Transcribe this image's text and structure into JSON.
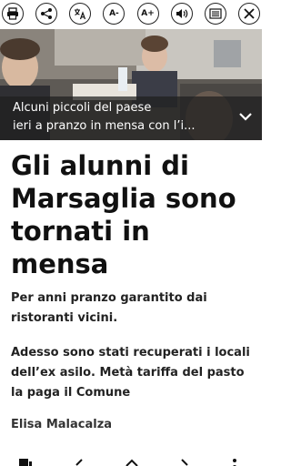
{
  "toolbar": {
    "icons": [
      "print-icon",
      "share-icon",
      "translate-icon",
      "text-smaller-icon",
      "text-larger-icon",
      "speaker-icon",
      "reader-icon",
      "close-icon"
    ],
    "text_smaller_label": "A-",
    "text_larger_label": "A+"
  },
  "hero": {
    "caption": "Alcuni piccoli del paese ieri a pranzo in mensa con l’i...",
    "caption_line1": "Alcuni piccoli del paese",
    "caption_line2": "ieri a pranzo in mensa con l’i..."
  },
  "article": {
    "title": "Gli alunni di Marsaglia sono tornati in mensa",
    "subtitle": "Per anni pranzo garantito dai ristoranti vicini.",
    "lead": "Adesso sono stati recuperati i locali dell’ex asilo. Metà tariffa del pasto la paga il Comune",
    "author": "Elisa Malacalza"
  },
  "bottom_nav": {
    "icons": [
      "sections-icon",
      "previous-icon",
      "up-icon",
      "next-icon",
      "more-icon"
    ]
  }
}
